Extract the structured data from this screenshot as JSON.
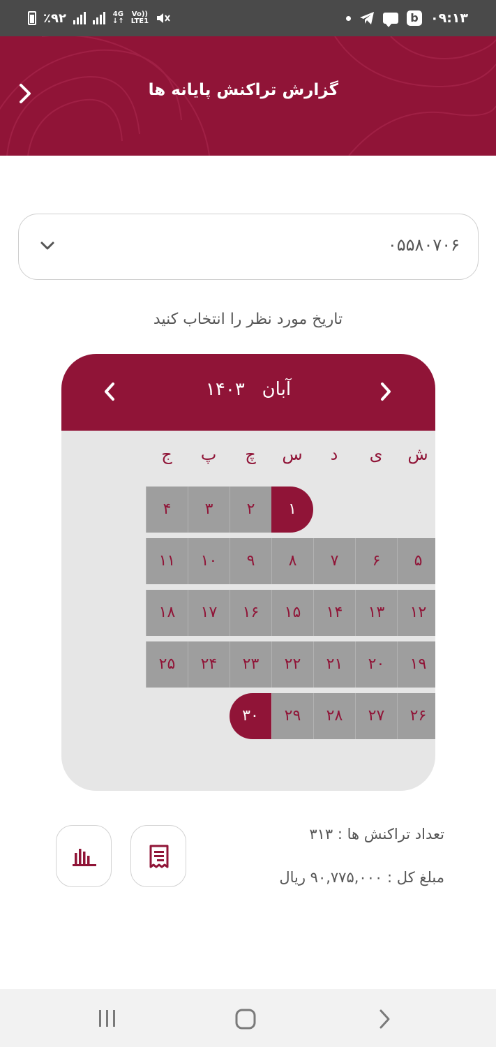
{
  "status_bar": {
    "battery": "٪۹۲",
    "network_top": "4G",
    "network_bottom": "↓↑",
    "volte_top": "Vo))",
    "volte_bottom": "LTE1",
    "time": "۰۹:۱۳"
  },
  "header": {
    "title": "گزارش تراکنش پایانه ها",
    "brand_color": "#901437"
  },
  "terminal_select": {
    "value": "۰۵۵۸۰۷۰۶"
  },
  "prompt": "تاریخ مورد نظر را انتخاب کنید",
  "calendar": {
    "month": "آبان",
    "year": "۱۴۰۳",
    "weekdays": [
      "ش",
      "ی",
      "د",
      "س",
      "چ",
      "پ",
      "ج"
    ],
    "days": [
      "۱",
      "۲",
      "۳",
      "۴",
      "۵",
      "۶",
      "۷",
      "۸",
      "۹",
      "۱۰",
      "۱۱",
      "۱۲",
      "۱۳",
      "۱۴",
      "۱۵",
      "۱۶",
      "۱۷",
      "۱۸",
      "۱۹",
      "۲۰",
      "۲۱",
      "۲۲",
      "۲۳",
      "۲۴",
      "۲۵",
      "۲۶",
      "۲۷",
      "۲۸",
      "۲۹",
      "۳۰"
    ],
    "first_day_weekday_index": 3,
    "range_start": "۱",
    "range_end": "۳۰"
  },
  "summary": {
    "count_label": "تعداد تراکنش ها :",
    "count_value": "۳۱۳",
    "total_label": "مبلغ کل :",
    "total_value": "۹۰,۷۷۵,۰۰۰ ریال"
  },
  "actions": {
    "chart_icon": "bar-chart-icon",
    "receipt_icon": "receipt-icon"
  },
  "navbar": {
    "recent_icon": "recent-apps-icon",
    "home_icon": "home-icon",
    "back_icon": "back-icon"
  }
}
